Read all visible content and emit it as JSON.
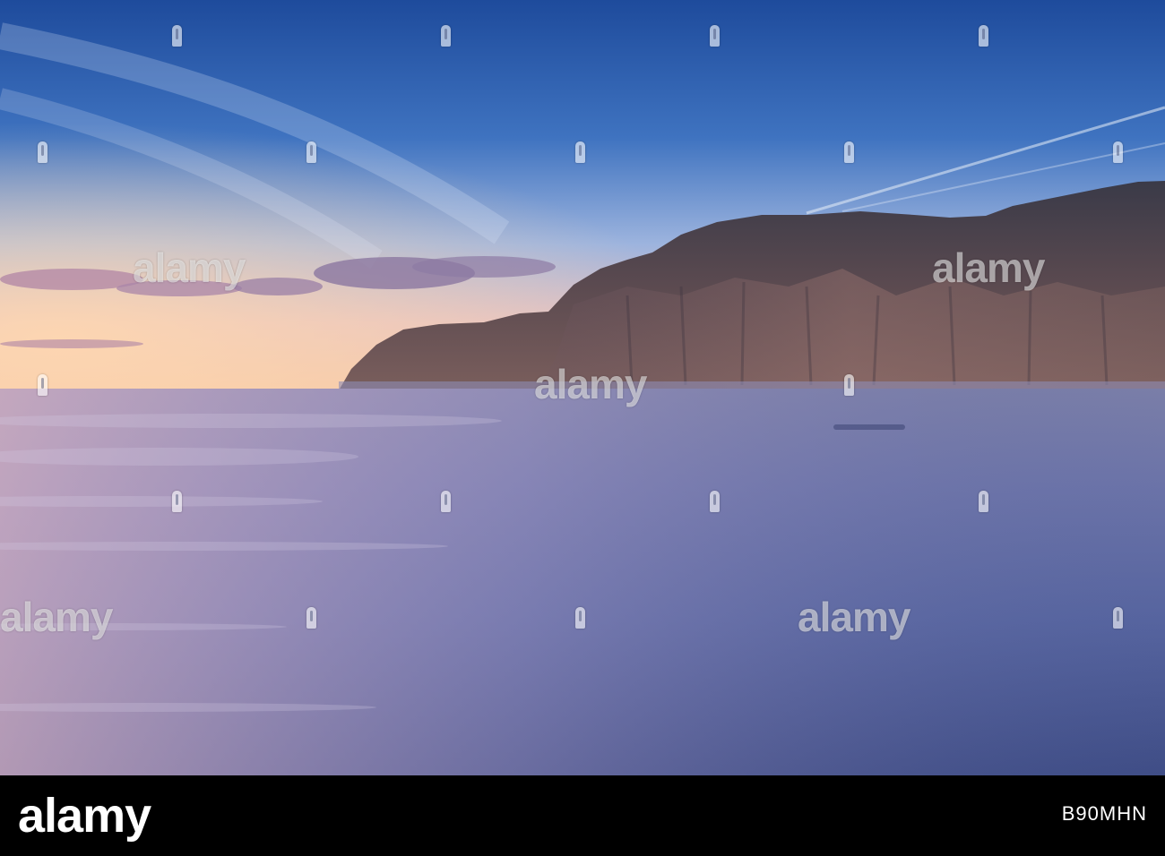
{
  "photo": {
    "scene": "coastal-cliff-sunset",
    "colors": {
      "sky_top": "#1f4fa0",
      "sky_mid": "#5f8fd0",
      "horizon_glow": "#f2c2a2",
      "sea": "#4c5d9a",
      "cliff": "#4a3f4a",
      "cliff_light": "#8a6a66"
    }
  },
  "watermark": {
    "text": "alamy"
  },
  "footer": {
    "logo": "alamy",
    "image_id": "B90MHN"
  }
}
